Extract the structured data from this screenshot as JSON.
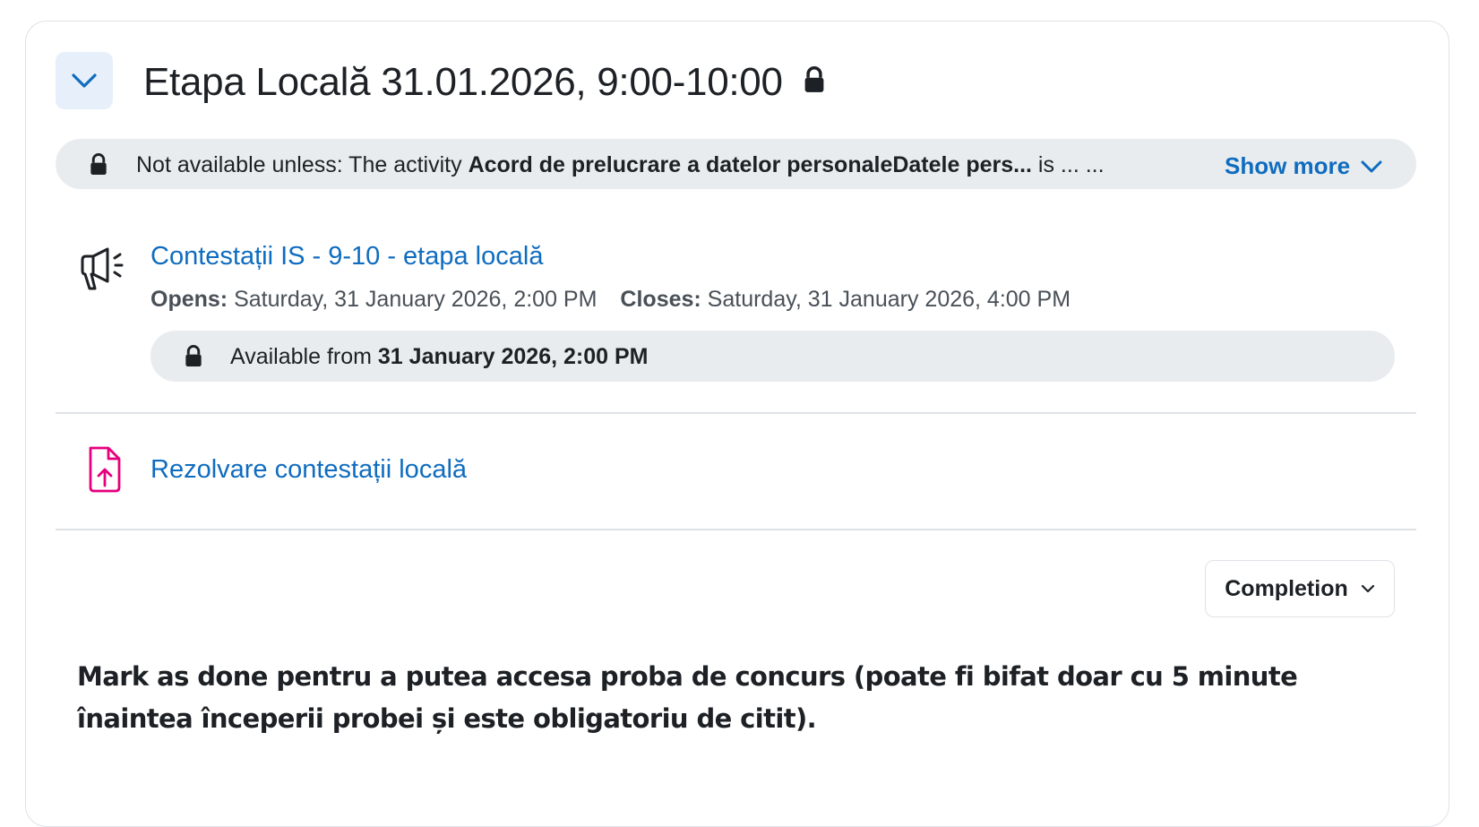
{
  "section": {
    "title": "Etapa Locală 31.01.2026, 9:00-10:00",
    "restriction": {
      "prefix": "Not available unless: The activity ",
      "activity": "Acord de prelucrare a datelor personaleDatele pers...",
      "suffix": " is ... ...",
      "show_more": "Show more"
    }
  },
  "activities": [
    {
      "icon": "megaphone-icon",
      "title": "Contestații IS - 9-10 - etapa locală",
      "opens_label": "Opens:",
      "opens_value": " Saturday, 31 January 2026, 2:00 PM",
      "closes_label": "Closes:",
      "closes_value": " Saturday, 31 January 2026, 4:00 PM",
      "availability_prefix": "Available from ",
      "availability_date": "31 January 2026, 2:00 PM"
    },
    {
      "icon": "file-upload-icon",
      "title": "Rezolvare contestații locală"
    }
  ],
  "completion": {
    "label": "Completion"
  },
  "note": "Mark as done pentru a putea accesa proba de concurs (poate fi bifat doar cu 5 minute înaintea începerii probei și este obligatoriu de citit).",
  "colors": {
    "link": "#0f6cbf",
    "accent_icon": "#e6007e",
    "bar": "#e9ecef"
  }
}
